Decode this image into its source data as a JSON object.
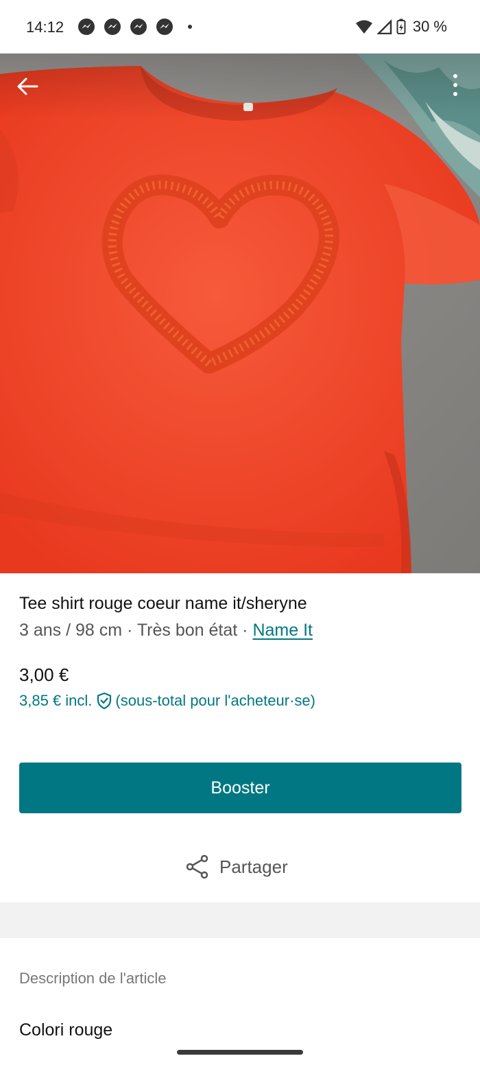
{
  "status_bar": {
    "time": "14:12",
    "notifications": [
      "messenger-icon",
      "messenger-icon",
      "messenger-icon",
      "messenger-icon"
    ],
    "battery": "30 %"
  },
  "photo": {
    "subject": "red-tshirt-heart-photo"
  },
  "item": {
    "title": "Tee shirt rouge coeur name it/sheryne",
    "meta_prefix": "3 ans / 98 cm · Très bon état · ",
    "brand": "Name It",
    "price": "3,00 €",
    "price_incl": "3,85 € incl.",
    "price_incl_note": "(sous-total pour l'acheteur·se)"
  },
  "actions": {
    "booster_label": "Booster",
    "share_label": "Partager"
  },
  "description": {
    "heading": "Description de l'article",
    "text": "Colori rouge"
  },
  "colors": {
    "accent": "#007782",
    "tshirt": "#f04a2c"
  }
}
